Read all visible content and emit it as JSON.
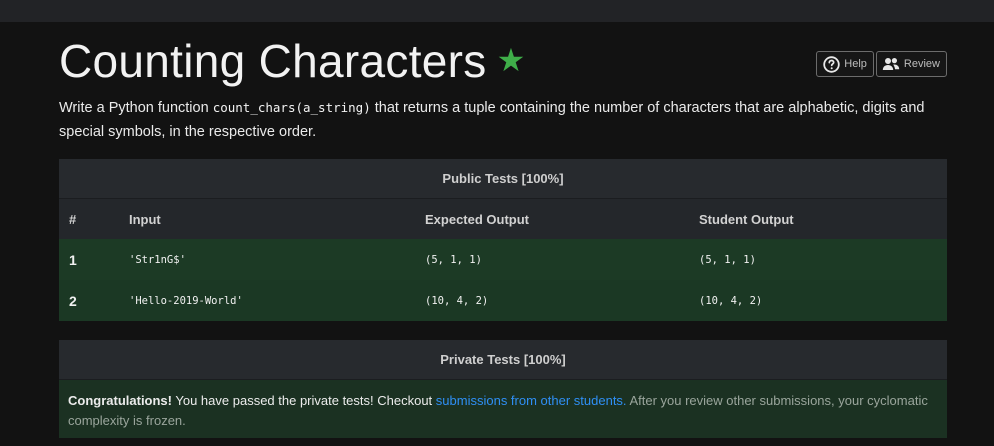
{
  "header": {
    "title": "Counting Characters",
    "star_glyph": "★",
    "help_label": "Help",
    "review_label": "Review"
  },
  "description": {
    "before": "Write a Python function ",
    "code": "count_chars(a_string)",
    "after": " that returns a tuple containing the number of characters that are alphabetic, digits and special symbols, in the respective order."
  },
  "public_tests": {
    "title": "Public Tests [100%]",
    "columns": [
      "#",
      "Input",
      "Expected Output",
      "Student Output"
    ],
    "rows": [
      {
        "num": "1",
        "input": "'Str1nG$'",
        "expected": "(5, 1, 1)",
        "student": "(5, 1, 1)"
      },
      {
        "num": "2",
        "input": "'Hello-2019-World'",
        "expected": "(10, 4, 2)",
        "student": "(10, 4, 2)"
      }
    ]
  },
  "private_tests": {
    "title": "Private Tests [100%]",
    "congrats": "Congratulations!",
    "text1": " You have passed the private tests! Checkout ",
    "link": "submissions from other students.",
    "text2": " After you review other submissions, your cyclomatic complexity is frozen."
  },
  "colors": {
    "star": "#3fae49",
    "link": "#2f8ff5",
    "pass_row": "#1c3a25"
  }
}
